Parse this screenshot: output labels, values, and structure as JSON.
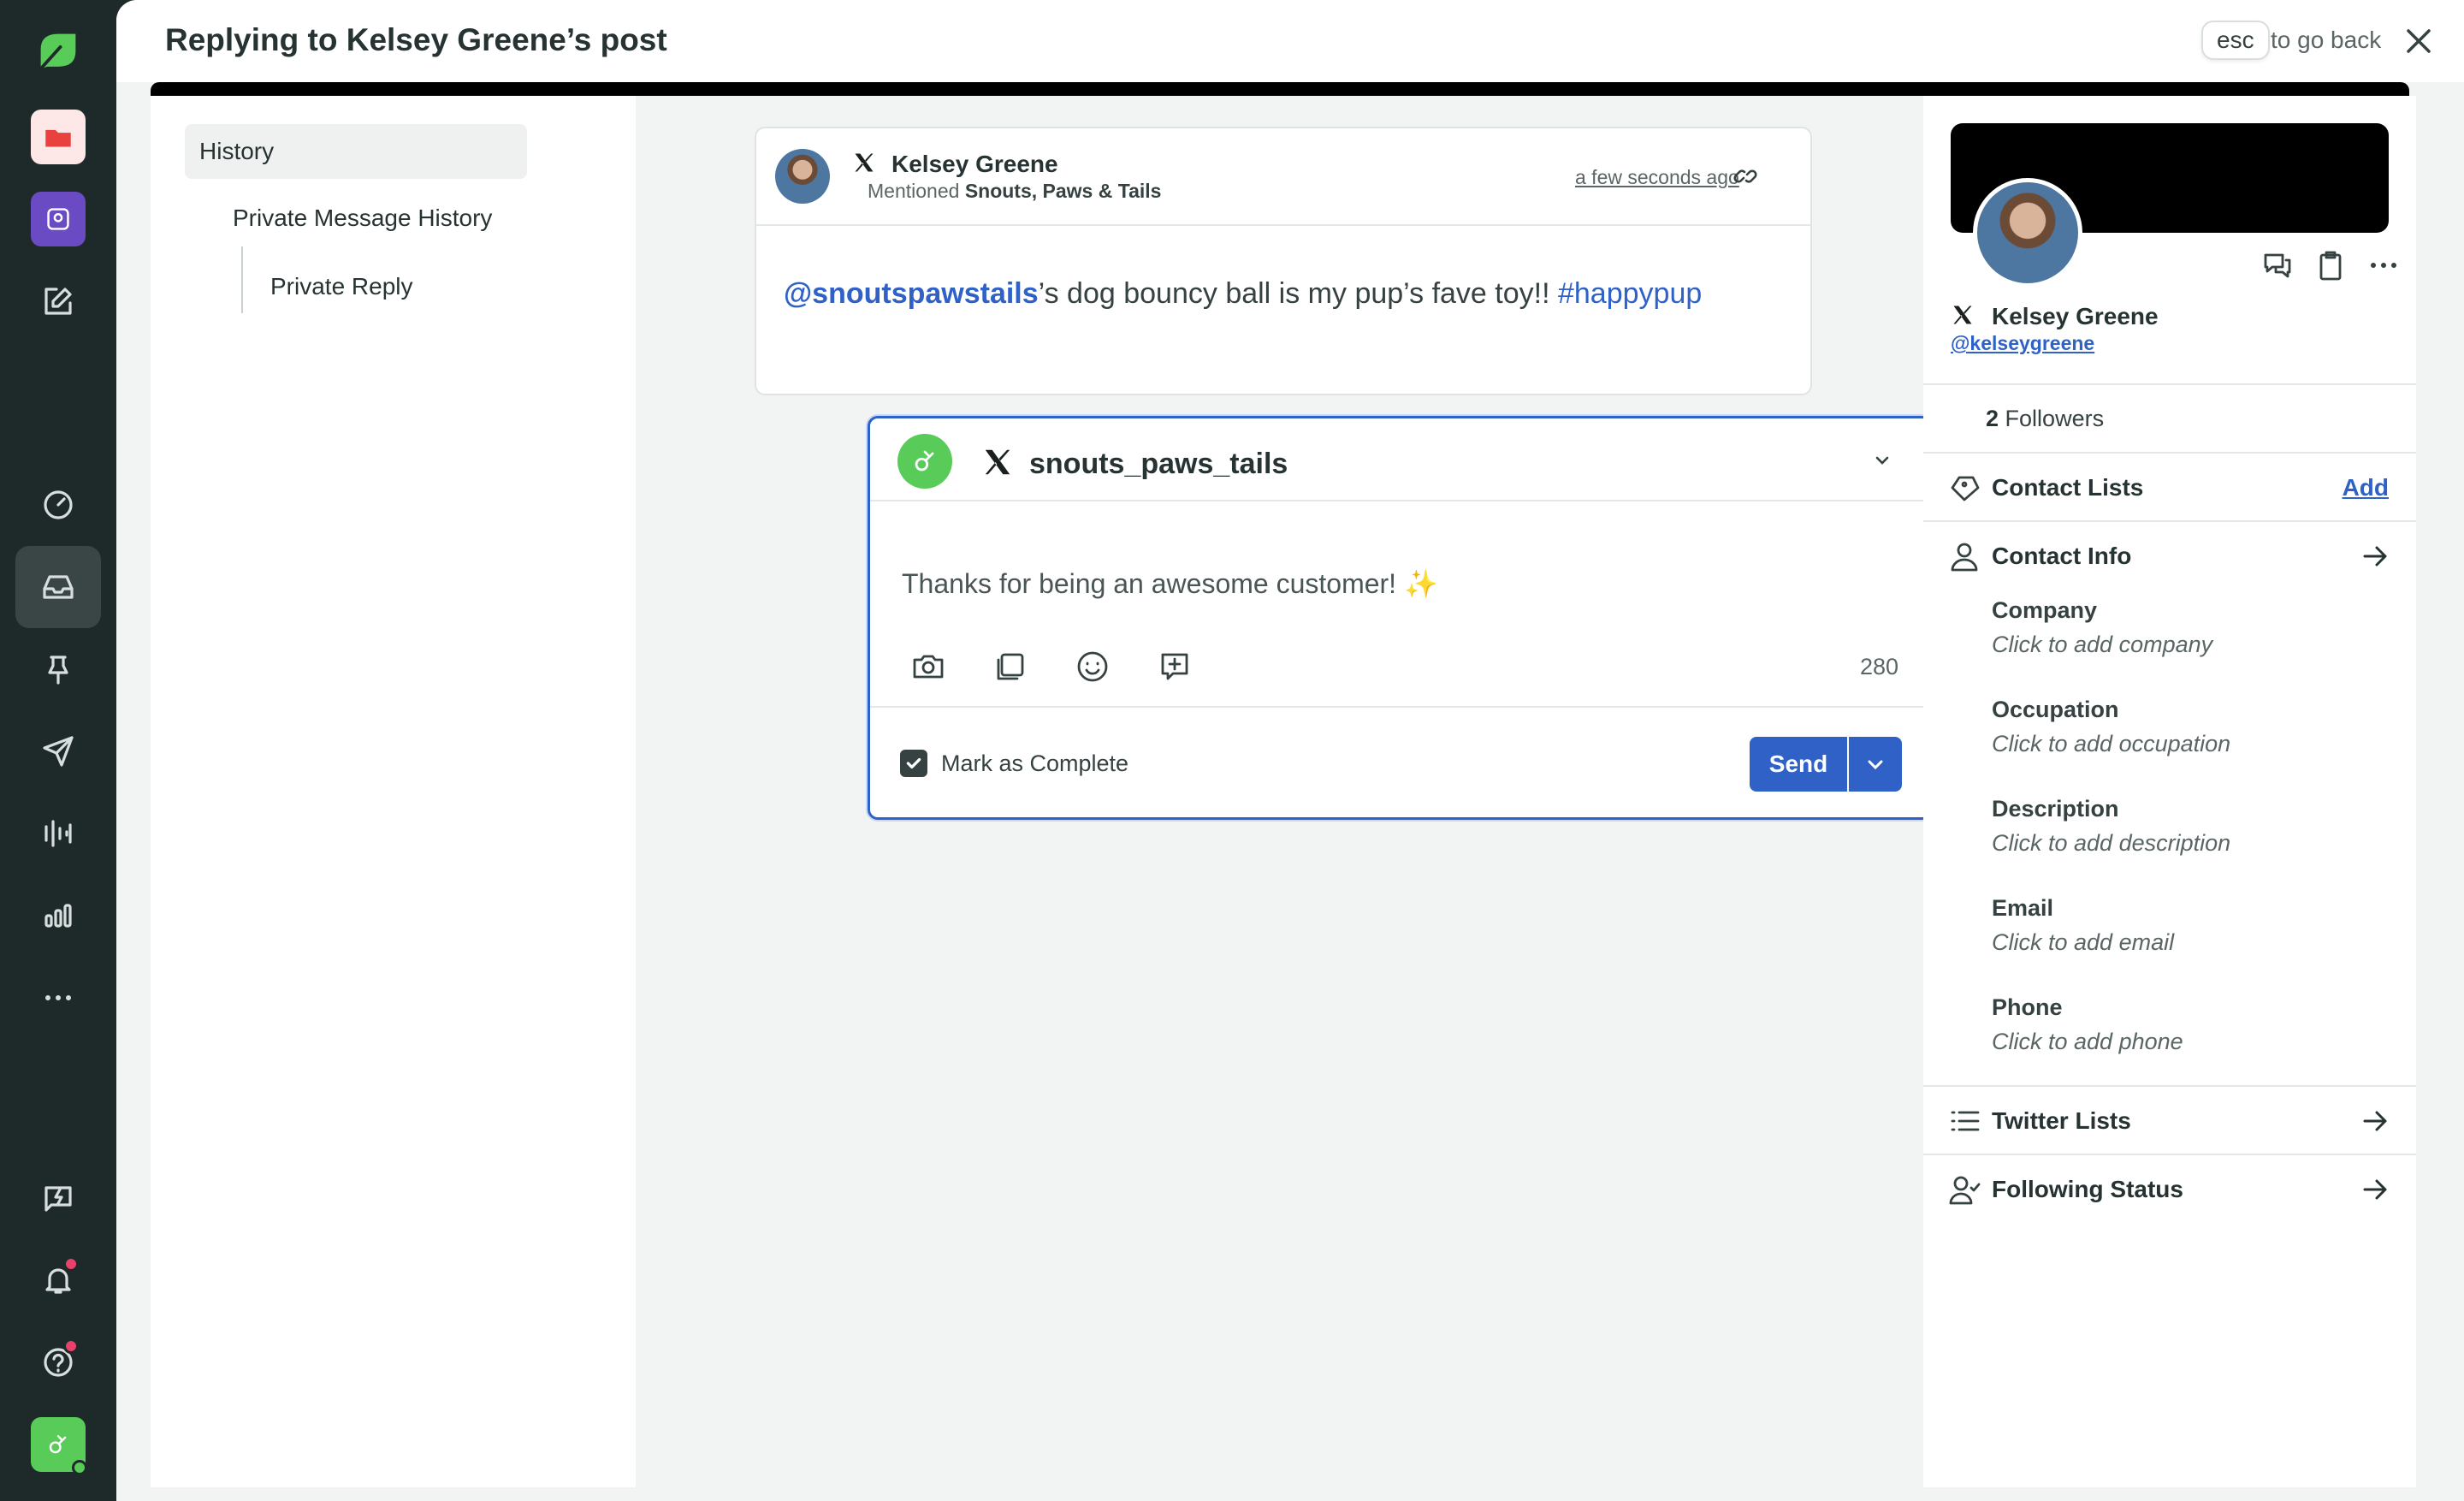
{
  "header": {
    "title": "Replying to Kelsey Greene’s post",
    "esc_key": "esc",
    "esc_hint": "to go back"
  },
  "history": {
    "items": [
      "History",
      "Private Message History",
      "Private Reply"
    ]
  },
  "post": {
    "author": "Kelsey Greene",
    "mentioned_prefix": "Mentioned",
    "mentioned_account": "Snouts, Paws & Tails",
    "time": "a few seconds ago",
    "body_mention": "@snoutspawstails",
    "body_text": "’s dog bouncy ball is my pup’s fave toy!! ",
    "body_hashtag": "#happypup"
  },
  "reply": {
    "account": "snouts_paws_tails",
    "text": "Thanks for being an awesome customer! ",
    "emoji": "✨",
    "char_count": "280",
    "mark_complete_label": "Mark as Complete",
    "mark_complete_checked": true,
    "send_label": "Send"
  },
  "profile": {
    "name": "Kelsey Greene",
    "handle": "@kelseygreene",
    "followers_count": "2",
    "followers_label": "Followers",
    "contact_lists_label": "Contact Lists",
    "add_label": "Add",
    "contact_info_label": "Contact Info",
    "fields": [
      {
        "label": "Company",
        "value": "Click to add company"
      },
      {
        "label": "Occupation",
        "value": "Click to add occupation"
      },
      {
        "label": "Description",
        "value": "Click to add description"
      },
      {
        "label": "Email",
        "value": "Click to add email"
      },
      {
        "label": "Phone",
        "value": "Click to add phone"
      }
    ],
    "twitter_lists_label": "Twitter Lists",
    "following_status_label": "Following Status"
  },
  "colors": {
    "accent": "#2f61c7",
    "rail": "#1e2a2a",
    "brand_green": "#59cb59",
    "notification": "#e8416b"
  }
}
